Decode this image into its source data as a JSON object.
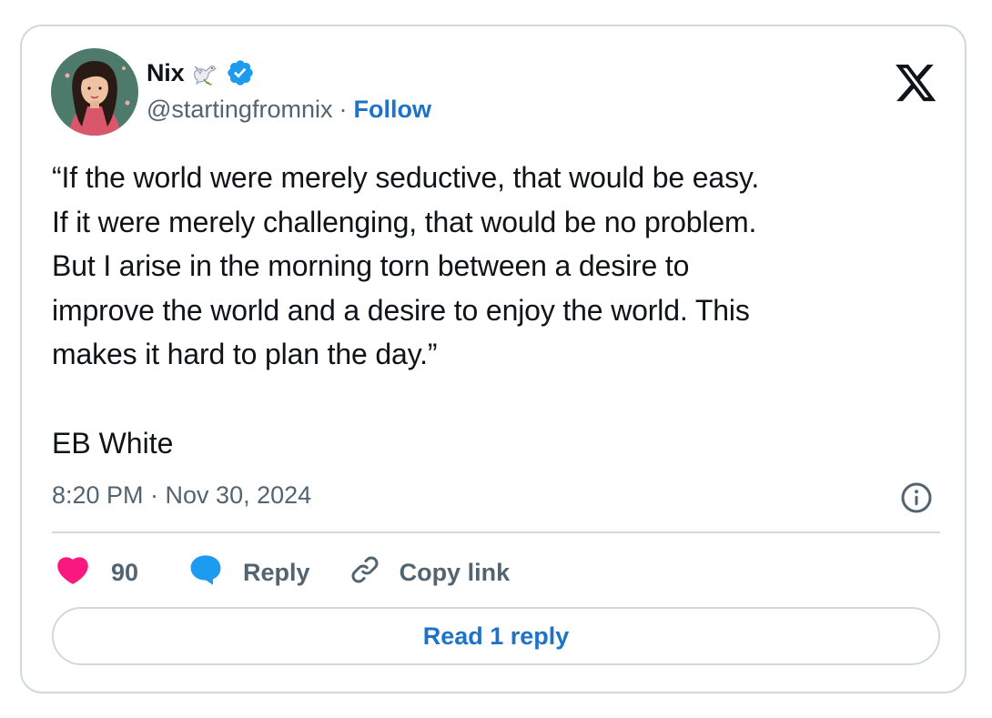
{
  "author": {
    "display_name": "Nix",
    "name_emoji": "dove-emoji",
    "verified": true,
    "handle": "@startingfromnix",
    "separator": "·",
    "follow_label": "Follow"
  },
  "tweet": {
    "lines": [
      "“If the world were merely seductive, that would be easy.",
      "If it were merely challenging, that would be no problem.",
      "But I arise in the morning torn between a desire to",
      "improve the world and a desire to enjoy the world. This",
      "makes it hard to plan the day.”"
    ],
    "attribution": "EB White",
    "timestamp": "8:20 PM · Nov 30, 2024"
  },
  "actions": {
    "like_count": "90",
    "reply_label": "Reply",
    "copy_link_label": "Copy link",
    "read_replies_label": "Read 1 reply"
  },
  "icons": {
    "brand": "x-logo-icon",
    "verified": "verified-badge-icon",
    "info": "info-icon",
    "like": "heart-icon",
    "reply": "reply-bubble-icon",
    "copy": "link-icon"
  },
  "colors": {
    "text_primary": "#0f1419",
    "text_secondary": "#536471",
    "link_blue": "#1d73c9",
    "verified_blue": "#1d9bf0",
    "like_pink": "#f91880",
    "reply_blue": "#1d9bf0",
    "border": "#cfd9de"
  }
}
